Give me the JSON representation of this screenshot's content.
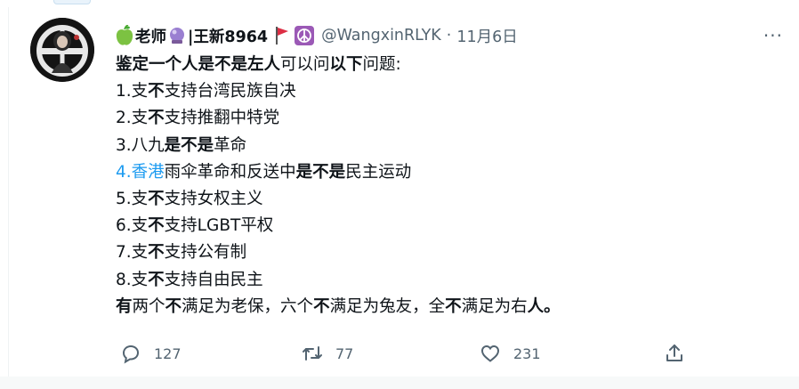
{
  "tweet": {
    "author_name_left": "老师",
    "author_name_right": "|王新8964",
    "handle": "@WangxinRLYK",
    "separator": "·",
    "date": "11月6日",
    "more_label": "···",
    "lines": [
      [
        {
          "t": "鉴定一个人是不是左人",
          "b": true
        },
        {
          "t": "可以问"
        },
        {
          "t": "以下",
          "b": true
        },
        {
          "t": "问题:"
        }
      ],
      [
        {
          "t": " 1.支"
        },
        {
          "t": "不",
          "b": true
        },
        {
          "t": "支持台湾民族自决"
        }
      ],
      [
        {
          "t": "2.支"
        },
        {
          "t": "不",
          "b": true
        },
        {
          "t": "支持推翻中特党"
        }
      ],
      [
        {
          "t": "3.八九"
        },
        {
          "t": "是不是",
          "b": true
        },
        {
          "t": "革命"
        }
      ],
      [
        {
          "t": "4.香港",
          "link": true
        },
        {
          "t": "雨伞革命和反送中"
        },
        {
          "t": "是不是",
          "b": true
        },
        {
          "t": "民主运动"
        }
      ],
      [
        {
          "t": "5.支"
        },
        {
          "t": "不",
          "b": true
        },
        {
          "t": "支持女权主义"
        }
      ],
      [
        {
          "t": "6.支"
        },
        {
          "t": "不",
          "b": true
        },
        {
          "t": "支持LGBT平权"
        }
      ],
      [
        {
          "t": "7.支"
        },
        {
          "t": "不",
          "b": true
        },
        {
          "t": "支持公有制"
        }
      ],
      [
        {
          "t": "8.支"
        },
        {
          "t": "不",
          "b": true
        },
        {
          "t": "支持自由民主"
        }
      ],
      [
        {
          "t": "有",
          "b": true
        },
        {
          "t": "两个"
        },
        {
          "t": "不",
          "b": true
        },
        {
          "t": "满足为老保，六个"
        },
        {
          "t": "不",
          "b": true
        },
        {
          "t": "满足为兔友，全"
        },
        {
          "t": "不",
          "b": true
        },
        {
          "t": "满足为右"
        },
        {
          "t": "人。",
          "b": true
        }
      ]
    ],
    "stats": {
      "replies": "127",
      "retweets": "77",
      "likes": "231"
    }
  }
}
